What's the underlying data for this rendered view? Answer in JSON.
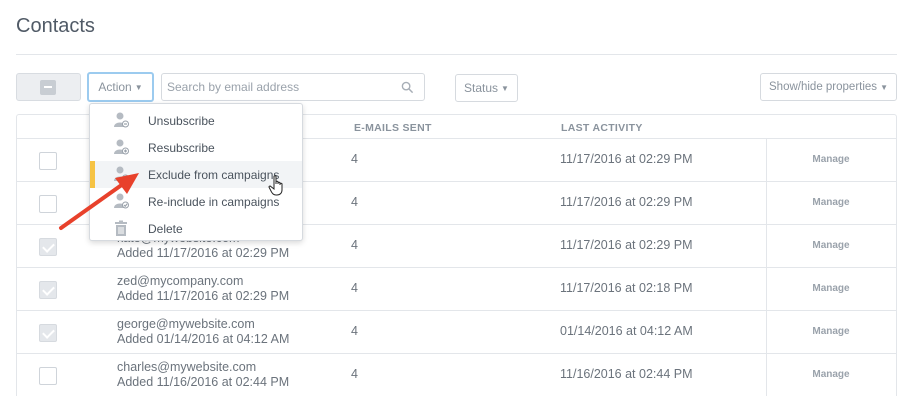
{
  "page": {
    "title": "Contacts"
  },
  "toolbar": {
    "action_label": "Action",
    "search_placeholder": "Search by email address",
    "status_label": "Status",
    "show_hide_label": "Show/hide properties"
  },
  "table": {
    "headers": {
      "sent": "E-MAILS SENT",
      "activity": "LAST ACTIVITY"
    },
    "rows": [
      {
        "email": "",
        "added": "",
        "sent": "4",
        "activity": "11/17/2016 at 02:29 PM",
        "manage": "Manage",
        "checked": false
      },
      {
        "email": "",
        "added": "",
        "sent": "4",
        "activity": "11/17/2016 at 02:29 PM",
        "manage": "Manage",
        "checked": false
      },
      {
        "email": "kate@mywebsite.com",
        "added": "Added 11/17/2016 at 02:29 PM",
        "sent": "4",
        "activity": "11/17/2016 at 02:29 PM",
        "manage": "Manage",
        "checked": true
      },
      {
        "email": "zed@mycompany.com",
        "added": "Added 11/17/2016 at 02:29 PM",
        "sent": "4",
        "activity": "11/17/2016 at 02:18 PM",
        "manage": "Manage",
        "checked": true
      },
      {
        "email": "george@mywebsite.com",
        "added": "Added 01/14/2016 at 04:12 AM",
        "sent": "4",
        "activity": "01/14/2016 at 04:12 AM",
        "manage": "Manage",
        "checked": true
      },
      {
        "email": "charles@mywebsite.com",
        "added": "Added 11/16/2016 at 02:44 PM",
        "sent": "4",
        "activity": "11/16/2016 at 02:44 PM",
        "manage": "Manage",
        "checked": false
      }
    ]
  },
  "dropdown": {
    "items": [
      {
        "label": "Unsubscribe",
        "icon": "user-minus-icon"
      },
      {
        "label": "Resubscribe",
        "icon": "user-plus-icon"
      },
      {
        "label": "Exclude from campaigns",
        "icon": "user-exclude-icon"
      },
      {
        "label": "Re-include in campaigns",
        "icon": "user-include-icon"
      },
      {
        "label": "Delete",
        "icon": "trash-icon"
      }
    ],
    "hovered_index": 2
  },
  "colors": {
    "accent_focus": "#9ccbef",
    "hover_marker": "#f6c344",
    "annotation_arrow": "#e8412b"
  }
}
